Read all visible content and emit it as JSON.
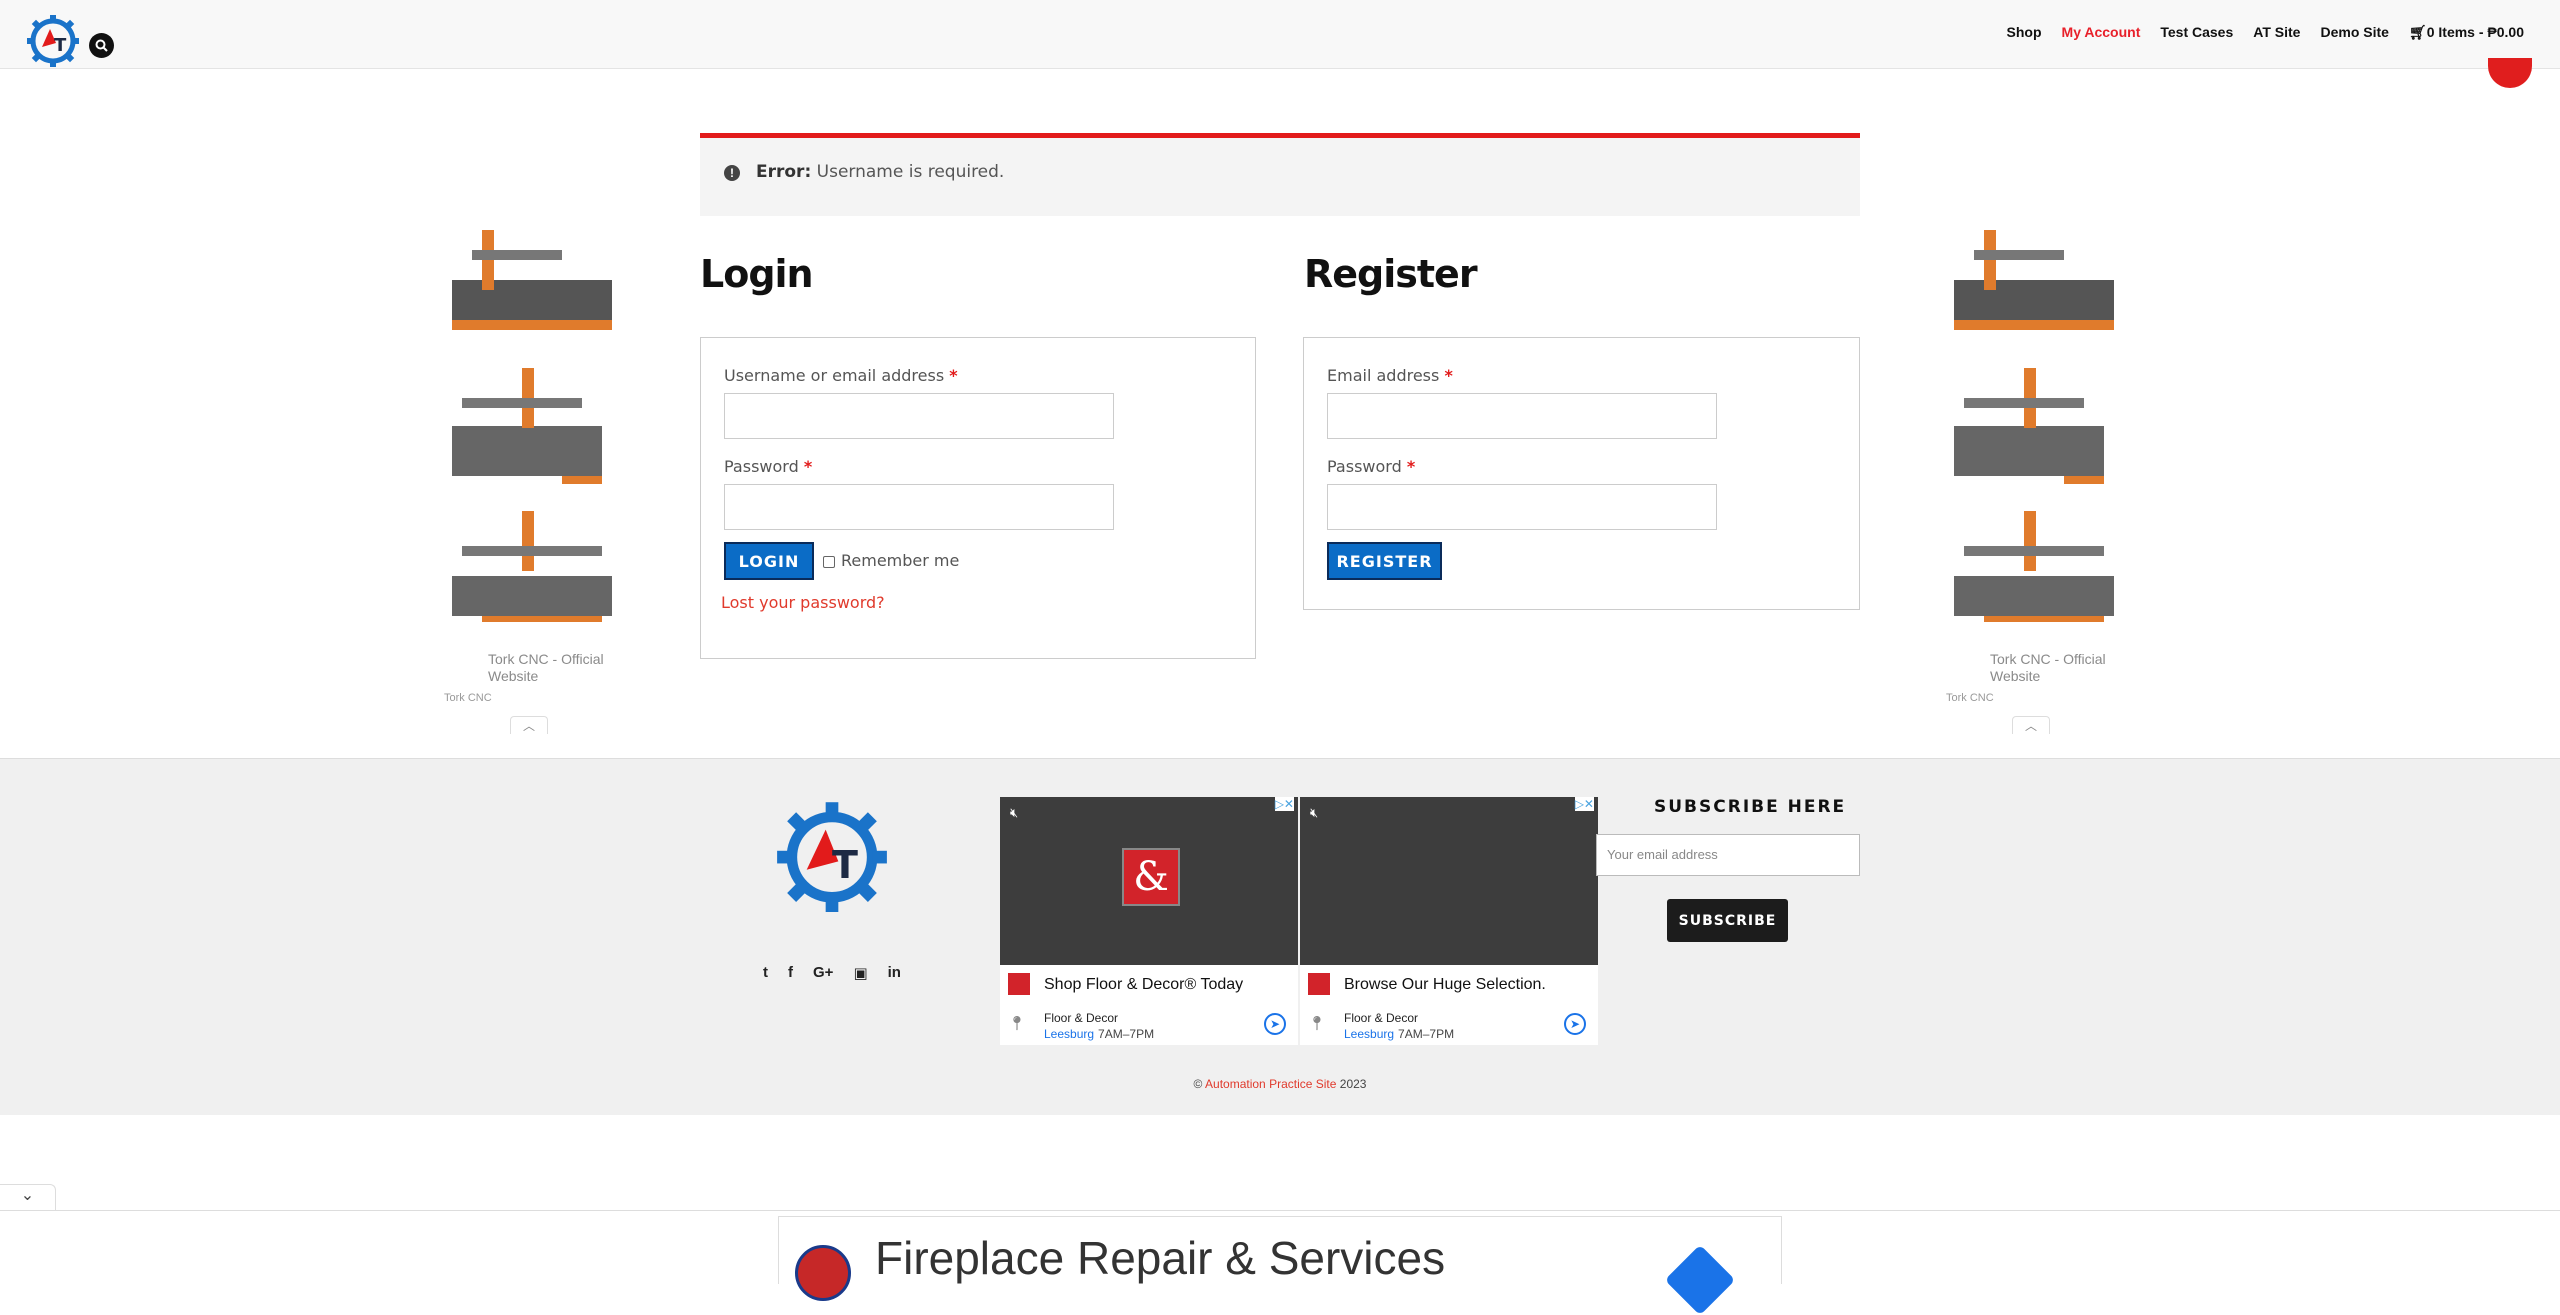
{
  "header": {
    "logo_alt": "AT",
    "nav": [
      {
        "label": "Shop",
        "active": false
      },
      {
        "label": "My Account",
        "active": true
      },
      {
        "label": "Test Cases",
        "active": false
      },
      {
        "label": "AT Site",
        "active": false
      },
      {
        "label": "Demo Site",
        "active": false
      },
      {
        "label": "0 Items - ₱0.00",
        "active": false
      }
    ]
  },
  "error": {
    "label": "Error:",
    "message": "Username is required."
  },
  "login": {
    "title": "Login",
    "username_label": "Username or email address",
    "password_label": "Password",
    "required_mark": "*",
    "button": "LOGIN",
    "remember": "Remember me",
    "lost_password": "Lost your password?"
  },
  "register": {
    "title": "Register",
    "email_label": "Email address",
    "password_label": "Password",
    "required_mark": "*",
    "button": "REGISTER"
  },
  "side_ads": {
    "title": "Tork CNC - Official Website",
    "advertiser": "Tork CNC"
  },
  "footer": {
    "video_ads": [
      {
        "headline": "Shop Floor & Decor® Today",
        "brand": "Floor & Decor",
        "location": "Leesburg",
        "hours": "7AM–7PM"
      },
      {
        "headline": "Browse Our Huge Selection.",
        "brand": "Floor & Decor",
        "location": "Leesburg",
        "hours": "7AM–7PM"
      }
    ],
    "subscribe_title": "SUBSCRIBE HERE",
    "subscribe_placeholder": "Your email address",
    "subscribe_button": "SUBSCRIBE",
    "copyright_prefix": "©",
    "copyright_link": "Automation Practice Site",
    "copyright_year": "2023"
  },
  "bottom_ad": {
    "text": "Fireplace Repair & Services"
  },
  "colors": {
    "accent_red": "#e21b1b",
    "button_blue": "#0b6cc6",
    "footer_bg": "#f0f0f0"
  }
}
